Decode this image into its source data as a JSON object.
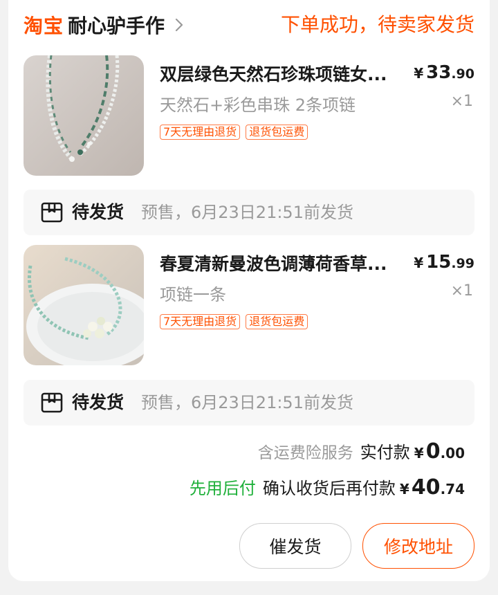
{
  "shop": {
    "brand": "淘宝",
    "name": "耐心驴手作"
  },
  "order_status": "下单成功，待卖家发货",
  "items": [
    {
      "title": "双层绿色天然石珍珠项链女...",
      "price_symbol": "¥",
      "price_int": "33",
      "price_dec": ".90",
      "spec": "天然石+彩色串珠 2条项链",
      "qty": "×1",
      "tags": [
        "7天无理由退货",
        "退货包运费"
      ],
      "ship_status": "待发货",
      "ship_note": "预售，6月23日21:51前发货"
    },
    {
      "title": "春夏清新曼波色调薄荷香草...",
      "price_symbol": "¥",
      "price_int": "15",
      "price_dec": ".99",
      "spec": "项链一条",
      "qty": "×1",
      "tags": [
        "7天无理由退货",
        "退货包运费"
      ],
      "ship_status": "待发货",
      "ship_note": "预售，6月23日21:51前发货"
    }
  ],
  "summary": {
    "insurance": "含运费险服务",
    "paid_label": "实付款",
    "paid_symbol": "¥",
    "paid_int": "0",
    "paid_dec": ".00",
    "paylater": "先用后付",
    "later_label": "确认收货后再付款",
    "later_symbol": "¥",
    "later_int": "40",
    "later_dec": ".74"
  },
  "buttons": {
    "remind": "催发货",
    "address": "修改地址"
  },
  "colors": {
    "accent": "#ff5000",
    "paylater": "#1fb03a",
    "muted": "#9a9a9a"
  }
}
